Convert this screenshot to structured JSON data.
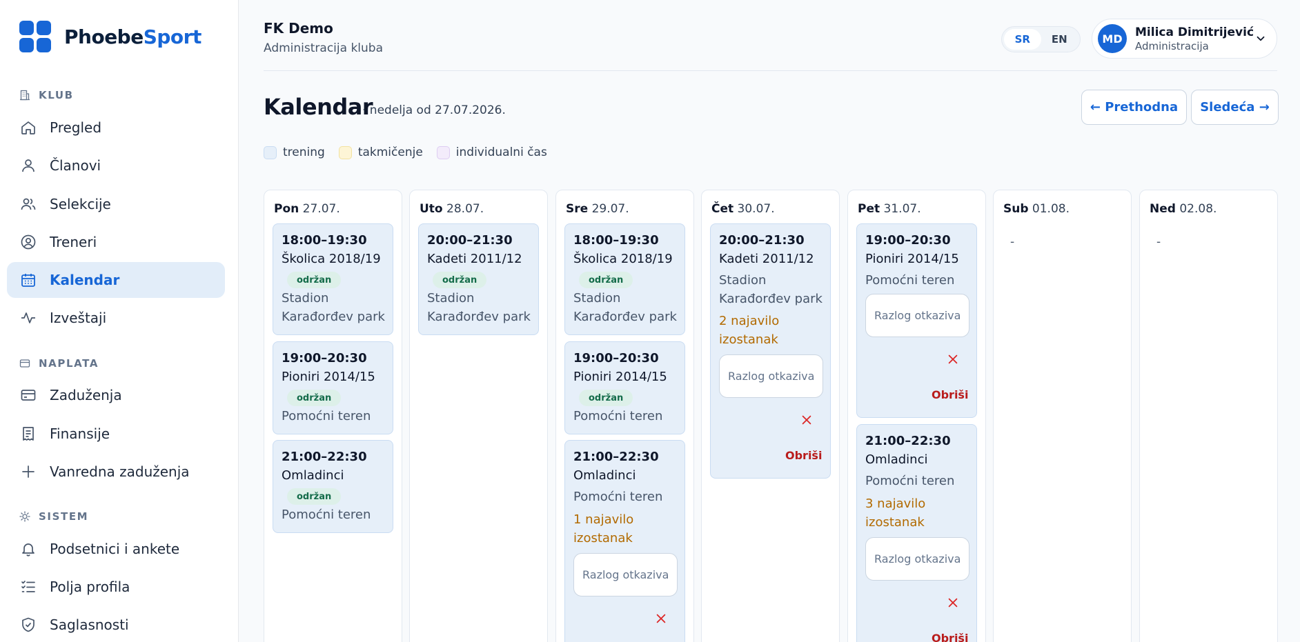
{
  "brand": {
    "name_a": "Phoebe",
    "name_b": "Sport"
  },
  "sidebar": {
    "sections": [
      {
        "label": "KLUB"
      },
      {
        "label": "NAPLATA"
      },
      {
        "label": "SISTEM"
      }
    ],
    "items": [
      {
        "label": "Pregled",
        "icon": "home-icon"
      },
      {
        "label": "Članovi",
        "icon": "user-icon"
      },
      {
        "label": "Selekcije",
        "icon": "users-icon"
      },
      {
        "label": "Treneri",
        "icon": "user-circle-icon"
      },
      {
        "label": "Kalendar",
        "icon": "calendar-icon",
        "active": true
      },
      {
        "label": "Izveštaji",
        "icon": "activity-icon"
      },
      {
        "label": "Zaduženja",
        "icon": "credit-card-icon"
      },
      {
        "label": "Finansije",
        "icon": "receipt-icon"
      },
      {
        "label": "Vanredna zaduženja",
        "icon": "plus-icon"
      },
      {
        "label": "Podsetnici i ankete",
        "icon": "bell-icon"
      },
      {
        "label": "Polja profila",
        "icon": "list-check-icon"
      },
      {
        "label": "Saglasnosti",
        "icon": "shield-check-icon"
      }
    ]
  },
  "header": {
    "club": "FK Demo",
    "subtitle": "Administracija kluba",
    "lang_sr": "SR",
    "lang_en": "EN",
    "user_initials": "MD",
    "user_name": "Milica Dimitrijević",
    "user_role": "Administracija"
  },
  "page": {
    "title": "Kalendar",
    "subtitle": "· nedelja od 27.07.2026.",
    "prev": "← Prethodna",
    "next": "Sledeća →",
    "legend": [
      {
        "label": "trening",
        "color": "#e6eff9",
        "border": "#c9dcf2"
      },
      {
        "label": "takmičenje",
        "color": "#fdf5d6",
        "border": "#f2e2a0"
      },
      {
        "label": "individualni čas",
        "color": "#f3ecfb",
        "border": "#ddcdf2"
      }
    ]
  },
  "colors": {
    "accent": "#1766d6",
    "event_bg": "#e6eff9",
    "held_badge": "#ddf0e9",
    "warning": "#b26a00",
    "danger": "#dc2626"
  },
  "calendar": {
    "days": [
      {
        "dow": "Pon",
        "date": "27.07.",
        "empty": ""
      },
      {
        "dow": "Uto",
        "date": "28.07.",
        "empty": ""
      },
      {
        "dow": "Sre",
        "date": "29.07.",
        "empty": ""
      },
      {
        "dow": "Čet",
        "date": "30.07.",
        "empty": ""
      },
      {
        "dow": "Pet",
        "date": "31.07.",
        "empty": ""
      },
      {
        "dow": "Sub",
        "date": "01.08.",
        "empty": "-"
      },
      {
        "dow": "Ned",
        "date": "02.08.",
        "empty": "-"
      }
    ],
    "events": {
      "mon_1": {
        "time": "18:00–19:30",
        "name": "Školica 2018/19",
        "status": "održan",
        "location": "Stadion Karađorđev park"
      },
      "mon_2": {
        "time": "19:00–20:30",
        "name": "Pioniri 2014/15",
        "status": "održan",
        "location": "Pomoćni teren"
      },
      "mon_3": {
        "time": "21:00–22:30",
        "name": "Omladinci",
        "status": "održan",
        "location": "Pomoćni teren"
      },
      "tue_1": {
        "time": "20:00–21:30",
        "name": "Kadeti 2011/12",
        "status": "održan",
        "location": "Stadion Karađorđev park"
      },
      "wed_1": {
        "time": "18:00–19:30",
        "name": "Školica 2018/19",
        "status": "održan",
        "location": "Stadion Karađorđev park"
      },
      "wed_2": {
        "time": "19:00–20:30",
        "name": "Pioniri 2014/15",
        "status": "održan",
        "location": "Pomoćni teren"
      },
      "wed_3": {
        "time": "21:00–22:30",
        "name": "Omladinci",
        "location": "Pomoćni teren",
        "absences": "1 najavilo izostanak",
        "reason_placeholder": "Razlog otkazivanja"
      },
      "thu_1": {
        "time": "20:00–21:30",
        "name": "Kadeti 2011/12",
        "location": "Stadion Karađorđev park",
        "absences": "2 najavilo izostanak",
        "reason_placeholder": "Razlog otkazivanja",
        "delete": "Obriši"
      },
      "fri_1": {
        "time": "19:00–20:30",
        "name": "Pioniri 2014/15",
        "location": "Pomoćni teren",
        "reason_placeholder": "Razlog otkazivanja",
        "delete": "Obriši"
      },
      "fri_2": {
        "time": "21:00–22:30",
        "name": "Omladinci",
        "location": "Pomoćni teren",
        "absences": "3 najavilo izostanak",
        "reason_placeholder": "Razlog otkazivanja",
        "delete": "Obriši"
      }
    }
  }
}
